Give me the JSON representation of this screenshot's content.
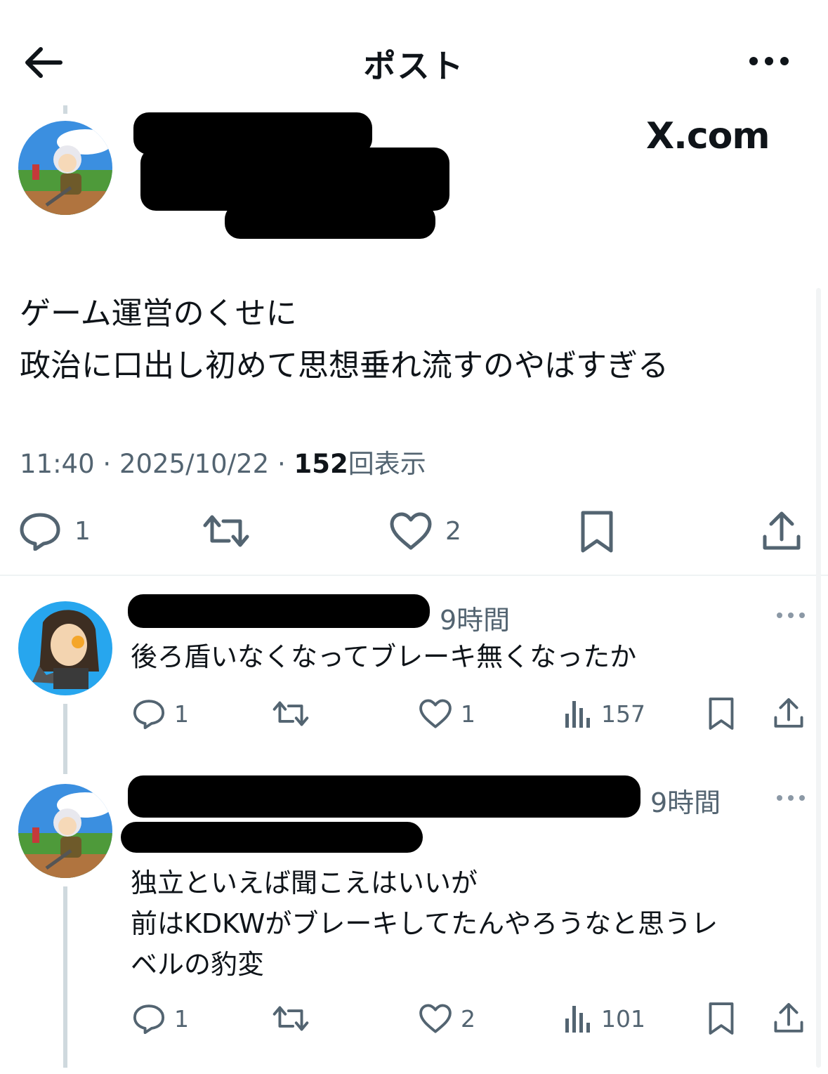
{
  "header": {
    "title": "ポスト",
    "back_icon": "arrow-left-icon",
    "more_icon": "more-horizontal-icon"
  },
  "post": {
    "watermark": "X.com",
    "text_lines": [
      "ゲーム運営のくせに",
      "政治に口出し初めて思想垂れ流すのやばすぎる"
    ],
    "time": "11:40",
    "date": "2025/10/22",
    "separator": "·",
    "view_count": "152",
    "view_label": "回表示",
    "actions": {
      "replies": "1",
      "likes": "2"
    }
  },
  "replies": [
    {
      "time": "9時間",
      "text_lines": [
        "後ろ盾いなくなってブレーキ無くなったか"
      ],
      "replies": "1",
      "likes": "1",
      "views": "157"
    },
    {
      "time": "9時間",
      "text_lines": [
        "独立といえば聞こえはいいが",
        "前はKDKWがブレーキしてたんやろうなと思うレ",
        "ベルの豹変"
      ],
      "replies": "1",
      "likes": "2",
      "views": "101"
    }
  ],
  "colors": {
    "text": "#0f1419",
    "secondary": "#536471",
    "divider": "#eff3f4",
    "thread_line": "#cfd9de"
  }
}
